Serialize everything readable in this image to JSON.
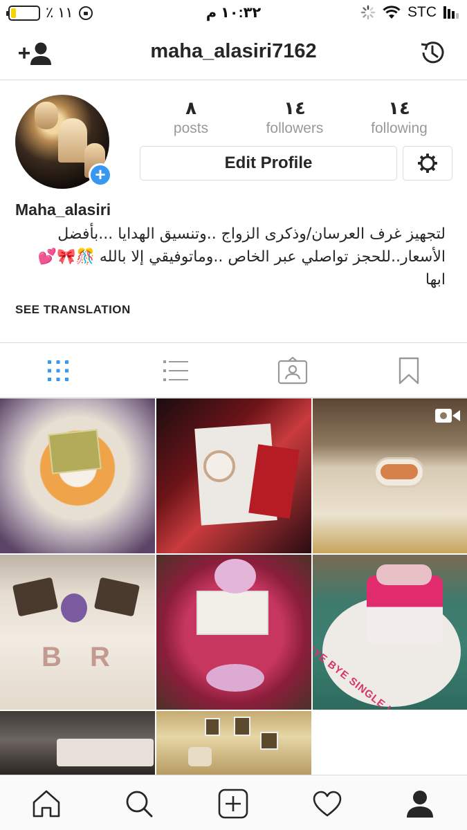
{
  "status": {
    "battery_text": "٪ ١١",
    "time": "١٠:٣٢ م",
    "carrier": "STC",
    "battery_level": 0.11
  },
  "header": {
    "username": "maha_alasiri7162",
    "left_icon": "add-user-icon",
    "right_icon": "history-icon"
  },
  "profile": {
    "posts": {
      "count": "٨",
      "label": "posts"
    },
    "followers": {
      "count": "١٤",
      "label": "followers"
    },
    "following": {
      "count": "١٤",
      "label": "following"
    },
    "edit_label": "Edit Profile",
    "name": "Maha_alasiri",
    "bio_lines": [
      "لتجهيز غرف العرسان/وذكرى الزواج ..وتنسيق الهدايا ...بأفضل",
      "الأسعار..للحجز تواصلي عبر الخاص ..وماتوفيقي إلا بالله 🎊🎀💕",
      "ابها"
    ],
    "see_translation": "SEE TRANSLATION"
  },
  "tabs": [
    "grid-view-icon",
    "list-view-icon",
    "tagged-photos-icon",
    "saved-icon"
  ],
  "grid_items": [
    {
      "name": "roses-gift-box-photo"
    },
    {
      "name": "watch-gift-photo"
    },
    {
      "name": "bed-decoration-video"
    },
    {
      "name": "bed-initials-photo"
    },
    {
      "name": "rose-box-photo"
    },
    {
      "name": "cake-photo",
      "caption": "BYE BYE SINGLE LIFE"
    },
    {
      "name": "living-room-photo"
    },
    {
      "name": "hotel-room-photo"
    }
  ],
  "bottom_nav": [
    "home-icon",
    "search-icon",
    "new-post-icon",
    "activity-icon",
    "profile-icon"
  ],
  "colors": {
    "accent": "#3897f0",
    "border": "#dbdbdb",
    "muted": "#999999"
  }
}
